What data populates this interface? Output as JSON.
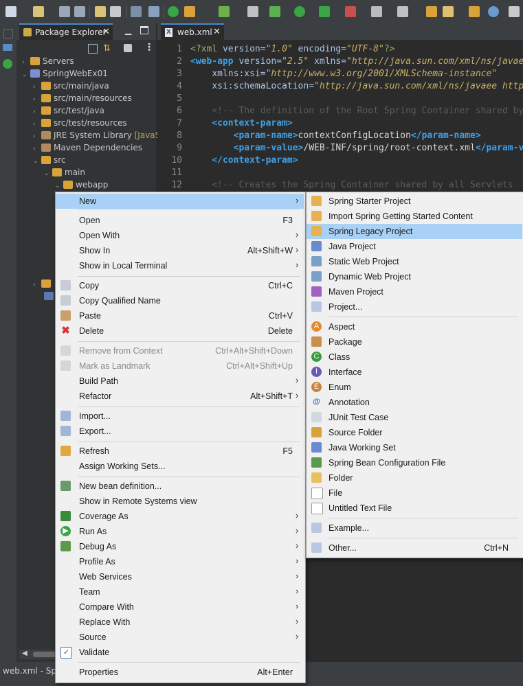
{
  "package_explorer": {
    "tab_label": "Package Explorer",
    "tree": [
      {
        "label": "Servers",
        "arrow": "›"
      },
      {
        "label": "SpringWebEx01",
        "arrow": "⌄"
      },
      {
        "label": "src/main/java",
        "arrow": "›"
      },
      {
        "label": "src/main/resources",
        "arrow": "›"
      },
      {
        "label": "src/test/java",
        "arrow": "›"
      },
      {
        "label": "src/test/resources",
        "arrow": "›"
      },
      {
        "label": "JRE System Library",
        "extra": "[JavaSE",
        "arrow": "›"
      },
      {
        "label": "Maven Dependencies",
        "arrow": "›"
      },
      {
        "label": "src",
        "arrow": "⌄"
      },
      {
        "label": "main",
        "arrow": "⌄"
      },
      {
        "label": "webapp",
        "arrow": "⌄"
      }
    ]
  },
  "editor": {
    "tab_label": "web.xml",
    "line_numbers": [
      "1",
      "2",
      "3",
      "4",
      "5",
      "6",
      "7",
      "8",
      "9",
      "10",
      "11",
      "12"
    ],
    "lines": {
      "l1": {
        "pi_open": "<?xml ",
        "a1": "version=",
        "v1": "\"1.0\"",
        "a2": " encoding=",
        "v2": "\"UTF-8\"",
        "pi_close": "?>"
      },
      "l2": {
        "t": "<web-app",
        "a1": " version=",
        "v1": "\"2.5\"",
        "a2": " xmlns=",
        "v2": "\"http://java.sun.com/xml/ns/javaee\""
      },
      "l3": {
        "a1": "xmlns:xsi=",
        "v1": "\"http://www.w3.org/2001/XMLSchema-instance\""
      },
      "l4": {
        "a1": "xsi:schemaLocation=",
        "v1": "\"http://java.sun.com/xml/ns/javaee http"
      },
      "l6": {
        "c": "<!-- The definition of the Root Spring Container shared by"
      },
      "l7": {
        "t": "<context-param>"
      },
      "l8": {
        "t1": "<param-name>",
        "txt": "contextConfigLocation",
        "t2": "</param-name>"
      },
      "l9": {
        "t1": "<param-value>",
        "txt": "/WEB-INF/spring/root-context.xml",
        "t2": "</param-v"
      },
      "l10": {
        "t": "</context-param>"
      },
      "l12": {
        "c": "<!-- Creates the Spring Container shared by all Servlets"
      }
    }
  },
  "status_bar": {
    "text": "web.xml - Spr"
  },
  "context_menu": {
    "items": [
      {
        "label": "New",
        "submenu": true,
        "highlight": true
      },
      {
        "label": "Open",
        "shortcut": "F3"
      },
      {
        "label": "Open With",
        "submenu": true
      },
      {
        "label": "Show In",
        "shortcut": "Alt+Shift+W",
        "submenu": true
      },
      {
        "label": "Show in Local Terminal",
        "submenu": true
      },
      {
        "label": "Copy",
        "shortcut": "Ctrl+C",
        "icon": "copy-icon"
      },
      {
        "label": "Copy Qualified Name",
        "icon": "copy-qualified-icon"
      },
      {
        "label": "Paste",
        "shortcut": "Ctrl+V",
        "icon": "paste-icon"
      },
      {
        "label": "Delete",
        "shortcut": "Delete",
        "icon": "delete-icon"
      },
      {
        "label": "Remove from Context",
        "shortcut": "Ctrl+Alt+Shift+Down",
        "disabled": true,
        "icon": "remove-context-icon"
      },
      {
        "label": "Mark as Landmark",
        "shortcut": "Ctrl+Alt+Shift+Up",
        "disabled": true,
        "icon": "landmark-icon"
      },
      {
        "label": "Build Path",
        "submenu": true
      },
      {
        "label": "Refactor",
        "shortcut": "Alt+Shift+T",
        "submenu": true
      },
      {
        "label": "Import...",
        "icon": "import-icon"
      },
      {
        "label": "Export...",
        "icon": "export-icon"
      },
      {
        "label": "Refresh",
        "shortcut": "F5",
        "icon": "refresh-icon"
      },
      {
        "label": "Assign Working Sets..."
      },
      {
        "label": "New bean definition...",
        "icon": "bean-icon"
      },
      {
        "label": "Show in Remote Systems view"
      },
      {
        "label": "Coverage As",
        "submenu": true,
        "icon": "coverage-icon"
      },
      {
        "label": "Run As",
        "submenu": true,
        "icon": "run-icon"
      },
      {
        "label": "Debug As",
        "submenu": true,
        "icon": "debug-icon"
      },
      {
        "label": "Profile As",
        "submenu": true
      },
      {
        "label": "Web Services",
        "submenu": true
      },
      {
        "label": "Team",
        "submenu": true
      },
      {
        "label": "Compare With",
        "submenu": true
      },
      {
        "label": "Replace With",
        "submenu": true
      },
      {
        "label": "Source",
        "submenu": true
      },
      {
        "label": "Validate",
        "icon": "checkbox-icon"
      },
      {
        "label": "Properties",
        "shortcut": "Alt+Enter"
      }
    ]
  },
  "new_submenu": {
    "items": [
      {
        "label": "Spring Starter Project",
        "icon": "spring-starter-icon"
      },
      {
        "label": "Import Spring Getting Started Content",
        "icon": "spring-import-icon"
      },
      {
        "label": "Spring Legacy Project",
        "icon": "spring-legacy-icon",
        "highlight": true
      },
      {
        "label": "Java Project",
        "icon": "java-project-icon"
      },
      {
        "label": "Static Web Project",
        "icon": "static-web-icon"
      },
      {
        "label": "Dynamic Web Project",
        "icon": "dynamic-web-icon"
      },
      {
        "label": "Maven Project",
        "icon": "maven-icon"
      },
      {
        "label": "Project...",
        "icon": "project-icon"
      },
      {
        "label": "Aspect",
        "icon": "aspect-icon"
      },
      {
        "label": "Package",
        "icon": "package-icon"
      },
      {
        "label": "Class",
        "icon": "class-icon"
      },
      {
        "label": "Interface",
        "icon": "interface-icon"
      },
      {
        "label": "Enum",
        "icon": "enum-icon"
      },
      {
        "label": "Annotation",
        "icon": "annotation-icon"
      },
      {
        "label": "JUnit Test Case",
        "icon": "junit-icon"
      },
      {
        "label": "Source Folder",
        "icon": "source-folder-icon"
      },
      {
        "label": "Java Working Set",
        "icon": "working-set-icon"
      },
      {
        "label": "Spring Bean Configuration File",
        "icon": "spring-bean-file-icon"
      },
      {
        "label": "Folder",
        "icon": "folder-icon"
      },
      {
        "label": "File",
        "icon": "file-icon"
      },
      {
        "label": "Untitled Text File",
        "icon": "text-file-icon"
      },
      {
        "label": "Example...",
        "icon": "example-icon"
      },
      {
        "label": "Other...",
        "shortcut": "Ctrl+N",
        "icon": "other-icon"
      }
    ]
  },
  "colors": {
    "menu_bg": "#f0f0f0",
    "highlight": "#a8d1f5",
    "editor_bg": "#2b2b2b",
    "tag": "#3fa0e8",
    "string": "#cbb06a"
  }
}
